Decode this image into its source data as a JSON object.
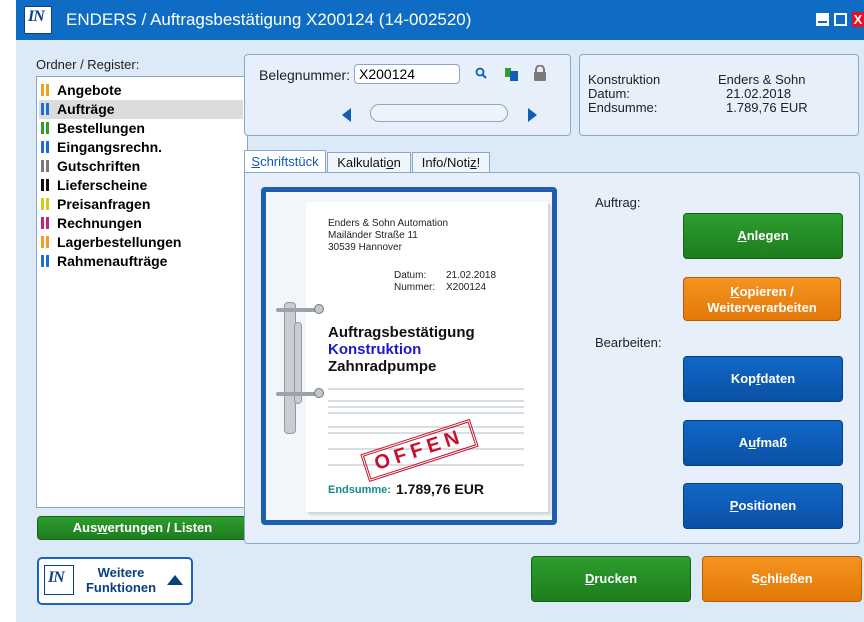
{
  "window": {
    "app_logo": "IN",
    "title": "ENDERS / Auftragsbestätigung X200124 (14-002520)",
    "close_glyph": "X"
  },
  "sidebar": {
    "label": "Ordner / Register:",
    "items": [
      {
        "label": "Angebote",
        "colors": [
          "#f0a020",
          "#f0a020"
        ],
        "selected": false
      },
      {
        "label": "Aufträge",
        "colors": [
          "#1d6fd6",
          "#1d6fd6"
        ],
        "selected": true
      },
      {
        "label": "Bestellungen",
        "colors": [
          "#2ea02e",
          "#2ea02e"
        ],
        "selected": false
      },
      {
        "label": "Eingangsrechn.",
        "colors": [
          "#1d6fd6",
          "#1d6fd6"
        ],
        "selected": false
      },
      {
        "label": "Gutschriften",
        "colors": [
          "#7a7a7a",
          "#7a7a7a"
        ],
        "selected": false
      },
      {
        "label": "Lieferscheine",
        "colors": [
          "#111111",
          "#111111"
        ],
        "selected": false
      },
      {
        "label": "Preisanfragen",
        "colors": [
          "#d8c81a",
          "#d8c81a"
        ],
        "selected": false
      },
      {
        "label": "Rechnungen",
        "colors": [
          "#c0267a",
          "#c0267a"
        ],
        "selected": false
      },
      {
        "label": "Lagerbestellungen",
        "colors": [
          "#f0a020",
          "#f0a020"
        ],
        "selected": false
      },
      {
        "label": "Rahmenaufträge",
        "colors": [
          "#1d6fd6",
          "#1d6fd6"
        ],
        "selected": false
      }
    ],
    "auswertungen": {
      "pre": "Aus",
      "ul": "w",
      "post": "ertungen / Listen"
    },
    "weitere": {
      "logo": "IN",
      "label": "Weitere Funktionen"
    }
  },
  "search": {
    "label": "Belegnummer:",
    "value": "X200124"
  },
  "summary": {
    "rows": [
      {
        "label": "Konstruktion",
        "value": "Enders & Sohn"
      },
      {
        "label": "Datum:",
        "value": "21.02.2018"
      },
      {
        "label": "Endsumme:",
        "value": "1.789,76 EUR"
      }
    ]
  },
  "tabs": [
    {
      "pre": "",
      "ul": "S",
      "post": "chriftstück",
      "active": true
    },
    {
      "pre": "Kalkulati",
      "ul": "o",
      "post": "n",
      "active": false
    },
    {
      "pre": "Info/Noti",
      "ul": "z",
      "post": "!",
      "active": false
    }
  ],
  "document": {
    "address": [
      "Enders & Sohn Automation",
      "Mailänder Straße 11",
      "30539 Hannover"
    ],
    "datum_label": "Datum:",
    "datum_value": "21.02.2018",
    "nummer_label": "Nummer:",
    "nummer_value": "X200124",
    "heading1": "Auftragsbestätigung",
    "heading2": "Konstruktion",
    "heading3": "Zahnradpumpe",
    "stamp": "OFFEN",
    "endsumme_label": "Endsumme:",
    "endsumme_value": "1.789,76 EUR",
    "colors": {
      "heading2": "#1a1acc"
    }
  },
  "actions": {
    "auftrag_label": "Auftrag:",
    "bearbeiten_label": "Bearbeiten:",
    "anlegen": {
      "pre": "",
      "ul": "A",
      "post": "nlegen"
    },
    "kopieren": {
      "line1_pre": "",
      "line1_ul": "K",
      "line1_post": "opieren /",
      "line2": "Weiterverarbeiten"
    },
    "kopfdaten": {
      "pre": "Kop",
      "ul": "f",
      "post": "daten"
    },
    "aufmass": {
      "pre": "A",
      "ul": "u",
      "post": "fmaß"
    },
    "positionen": {
      "pre": "",
      "ul": "P",
      "post": "ositionen"
    }
  },
  "footer": {
    "drucken": {
      "pre": "",
      "ul": "D",
      "post": "rucken"
    },
    "schliessen": {
      "pre": "S",
      "ul": "c",
      "post": "hließen"
    }
  },
  "colors": {
    "titlebar": "#0f6cc4",
    "green": "#2e9d2e",
    "orange": "#f59420",
    "blue": "#1267c6"
  }
}
